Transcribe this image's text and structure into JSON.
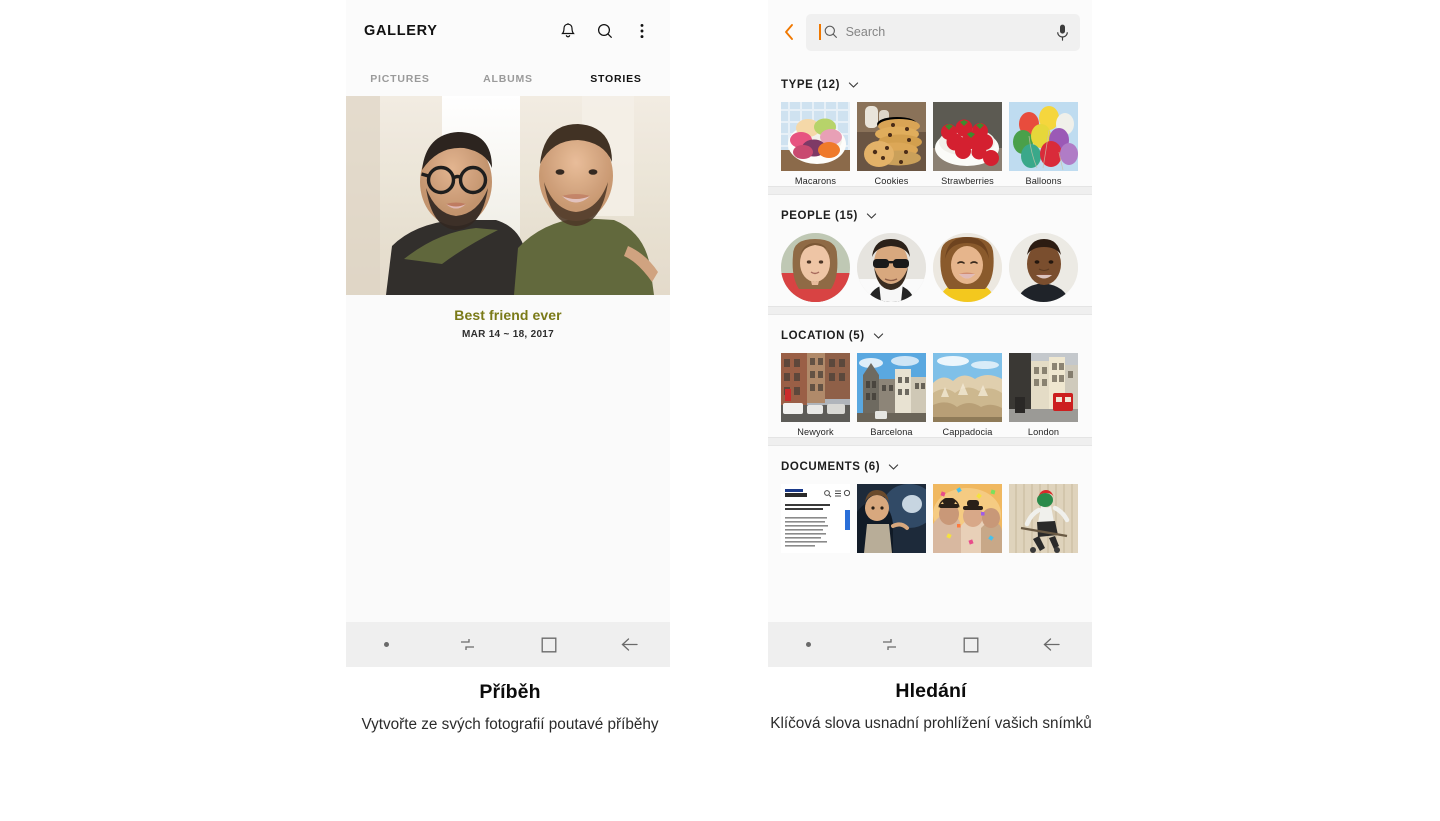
{
  "left_phone": {
    "header": {
      "title": "GALLERY",
      "icons": [
        {
          "name": "notification-bell-icon",
          "glyph": "bell"
        },
        {
          "name": "search-icon",
          "glyph": "magnifier"
        },
        {
          "name": "more-options-icon",
          "glyph": "kebab"
        }
      ]
    },
    "tabs": [
      {
        "label": "PICTURES",
        "active": false
      },
      {
        "label": "ALBUMS",
        "active": false
      },
      {
        "label": "STORIES",
        "active": true
      }
    ],
    "story": {
      "title": "Best friend ever",
      "title_color": "#7a7a18",
      "date": "MAR 14 ~ 18, 2017",
      "photo_alt": "Two smiling men with beards, one wearing glasses and a dark tank top, the other in an olive green t-shirt, arms around each other"
    },
    "navbar": [
      {
        "name": "nav-dot",
        "glyph": "dot"
      },
      {
        "name": "recents-icon",
        "glyph": "recents"
      },
      {
        "name": "home-icon",
        "glyph": "home"
      },
      {
        "name": "back-icon",
        "glyph": "back"
      }
    ]
  },
  "right_phone": {
    "search": {
      "back_label": "Back",
      "placeholder": "Search",
      "value": "",
      "caret_color": "#f07800",
      "mic_label": "Voice search"
    },
    "sections": [
      {
        "key": "type",
        "title": "TYPE (12)",
        "count": 12,
        "layout": "square",
        "items": [
          {
            "label": "Macarons",
            "gfx": "macarons"
          },
          {
            "label": "Cookies",
            "gfx": "cookies"
          },
          {
            "label": "Strawberries",
            "gfx": "strawberries"
          },
          {
            "label": "Balloons",
            "gfx": "balloons"
          }
        ]
      },
      {
        "key": "people",
        "title": "PEOPLE (15)",
        "count": 15,
        "layout": "circle",
        "items": [
          {
            "label": "",
            "gfx": "person-woman-red"
          },
          {
            "label": "",
            "gfx": "person-man-sunglasses"
          },
          {
            "label": "",
            "gfx": "person-woman-yellow"
          },
          {
            "label": "",
            "gfx": "person-man-smiling"
          }
        ]
      },
      {
        "key": "location",
        "title": "LOCATION (5)",
        "count": 5,
        "layout": "square",
        "items": [
          {
            "label": "Newyork",
            "gfx": "newyork"
          },
          {
            "label": "Barcelona",
            "gfx": "barcelona"
          },
          {
            "label": "Cappadocia",
            "gfx": "cappadocia"
          },
          {
            "label": "London",
            "gfx": "london"
          }
        ]
      },
      {
        "key": "documents",
        "title": "DOCUMENTS (6)",
        "count": 6,
        "layout": "square-nolabel",
        "items": [
          {
            "label": "",
            "gfx": "doc-article"
          },
          {
            "label": "",
            "gfx": "doc-boy"
          },
          {
            "label": "",
            "gfx": "doc-confetti"
          },
          {
            "label": "",
            "gfx": "doc-skater"
          }
        ]
      }
    ],
    "navbar": [
      {
        "name": "nav-dot",
        "glyph": "dot"
      },
      {
        "name": "recents-icon",
        "glyph": "recents"
      },
      {
        "name": "home-icon",
        "glyph": "home"
      },
      {
        "name": "back-icon",
        "glyph": "back"
      }
    ]
  },
  "captions": {
    "left": {
      "title": "Příběh",
      "body": "Vytvořte ze svých fotografií poutavé příběhy"
    },
    "right": {
      "title": "Hledání",
      "body": "Klíčová slova usnadní prohlížení vašich snímků"
    }
  }
}
